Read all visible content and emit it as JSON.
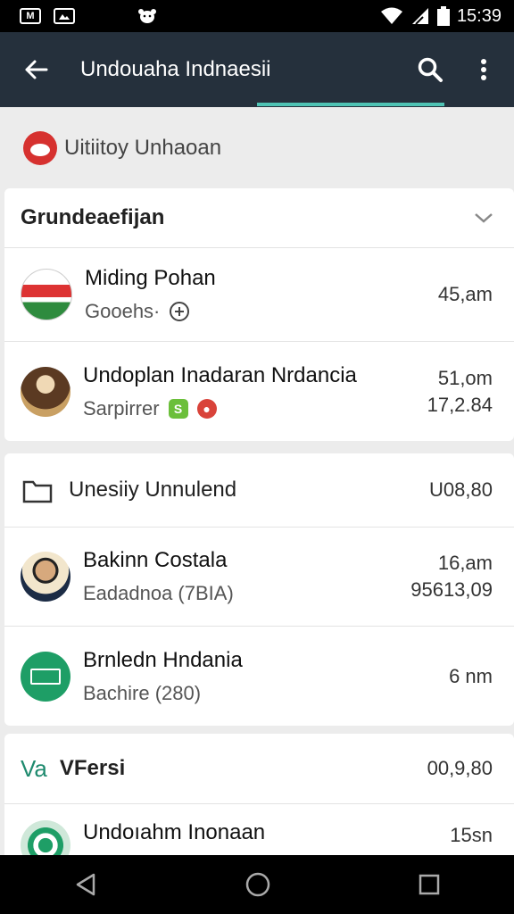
{
  "status_bar": {
    "time": "15:39",
    "icons": [
      "gmail-icon",
      "photos-icon",
      "bear-icon",
      "wifi-icon",
      "signal-icon",
      "battery-icon"
    ]
  },
  "app_bar": {
    "title": "Undouaha Indnaesii",
    "icons": [
      "back-arrow-icon",
      "search-icon",
      "more-vert-icon"
    ],
    "colors": {
      "background": "#25303c",
      "indicator": "#4fc3b4"
    }
  },
  "subheader": {
    "title": "Uitiitoy Unhaoan"
  },
  "section1": {
    "title": "Grundeaefijan",
    "rows": [
      {
        "title": "Miding Pohan",
        "subtitle": "Gooehs·",
        "time": "45,am",
        "time2": ""
      },
      {
        "title": "Undoplan Inadaran Nrdancia",
        "subtitle": "Sarpirrer",
        "time": "51,om",
        "time2": "17,2.84"
      }
    ]
  },
  "section2": {
    "title": "Unesiiy Unnulend",
    "value": "U08,80",
    "rows": [
      {
        "title": "Bakinn Costala",
        "subtitle": "Eadadnoa (7BIA)",
        "time": "16,am",
        "time2": "95613,09"
      },
      {
        "title": "Brnledn Hndania",
        "subtitle": "Bachire (280)",
        "time": "6 nm",
        "time2": ""
      }
    ]
  },
  "section3": {
    "prefix": "Va",
    "title": "VFersi",
    "value": "00,9,80",
    "rows": [
      {
        "title": "Undoıahm Inonaan",
        "time": "15sn"
      }
    ]
  }
}
